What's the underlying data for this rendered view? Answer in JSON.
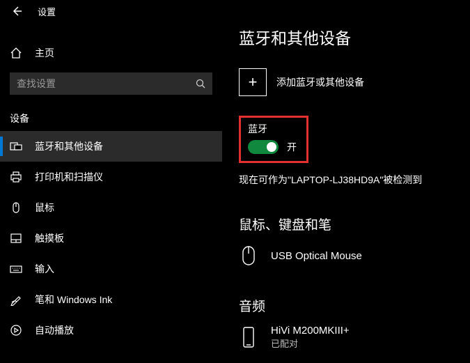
{
  "header": {
    "title": "设置"
  },
  "sidebar": {
    "home_label": "主页",
    "search_placeholder": "查找设置",
    "section_label": "设备",
    "items": [
      {
        "label": "蓝牙和其他设备"
      },
      {
        "label": "打印机和扫描仪"
      },
      {
        "label": "鼠标"
      },
      {
        "label": "触摸板"
      },
      {
        "label": "输入"
      },
      {
        "label": "笔和 Windows Ink"
      },
      {
        "label": "自动播放"
      }
    ]
  },
  "main": {
    "title": "蓝牙和其他设备",
    "add_device_label": "添加蓝牙或其他设备",
    "bluetooth_label": "蓝牙",
    "toggle_state": "开",
    "discoverable_text": "现在可作为\"LAPTOP-LJ38HD9A\"被检测到",
    "section_mouse": "鼠标、键盘和笔",
    "mouse_name": "USB Optical Mouse",
    "section_audio": "音频",
    "audio_name": "HiVi M200MKIII+",
    "audio_status": "已配对"
  }
}
